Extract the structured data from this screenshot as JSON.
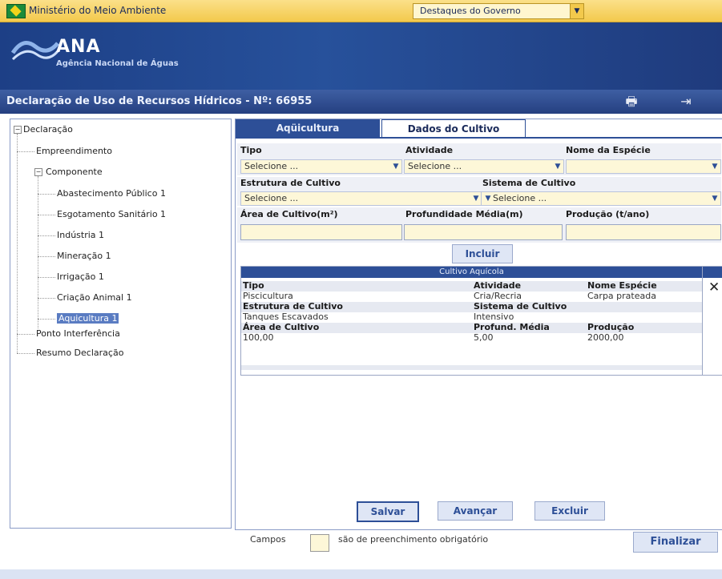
{
  "gov_bar": {
    "title": "Ministério do Meio Ambiente",
    "dropdown_value": "Destaques do Governo"
  },
  "brand": {
    "name": "ANA",
    "subtitle": "Agência Nacional de Águas"
  },
  "page": {
    "title": "Declaração de Uso de Recursos Hídricos - Nº: 66955"
  },
  "tree": {
    "root": "Declaração",
    "items": {
      "empreendimento": "Empreendimento",
      "componente": "Componente",
      "abastecimento": "Abastecimento Público 1",
      "esgotamento": "Esgotamento Sanitário 1",
      "industria": "Indústria 1",
      "mineracao": "Mineração 1",
      "irrigacao": "Irrigação 1",
      "criacao": "Criação Animal 1",
      "aquicultura": "Aquicultura 1",
      "ponto": "Ponto Interferência",
      "resumo": "Resumo Declaração"
    }
  },
  "tabs": {
    "aquicultura": "Aqüicultura",
    "dados": "Dados do Cultivo"
  },
  "form": {
    "tipo_label": "Tipo",
    "atividade_label": "Atividade",
    "especie_label": "Nome da Espécie",
    "estrutura_label": "Estrutura de Cultivo",
    "sistema_label": "Sistema de Cultivo",
    "area_label": "Área de Cultivo(m²)",
    "profundidade_label": "Profundidade Média(m)",
    "producao_label": "Produção (t/ano)",
    "placeholder_select": "Selecione ...",
    "incluir": "Incluir"
  },
  "grid": {
    "title": "Cultivo Aquícola",
    "labels": {
      "tipo": "Tipo",
      "atividade": "Atividade",
      "especie": "Nome Espécie",
      "estrutura": "Estrutura de Cultivo",
      "sistema": "Sistema de Cultivo",
      "area": "Área de Cultivo",
      "profund": "Profund. Média",
      "producao": "Produção"
    },
    "values": {
      "tipo": "Piscicultura",
      "atividade": "Cria/Recria",
      "especie": "Carpa prateada",
      "estrutura": "Tanques Escavados",
      "sistema": "Intensivo",
      "area": "100,00",
      "profund": "5,00",
      "producao": "2000,00"
    }
  },
  "buttons": {
    "salvar": "Salvar",
    "avancar": "Avançar",
    "excluir": "Excluir",
    "finalizar": "Finalizar"
  },
  "footer": {
    "campos": "Campos",
    "obrigatorio": "são de preenchimento obrigatório"
  }
}
